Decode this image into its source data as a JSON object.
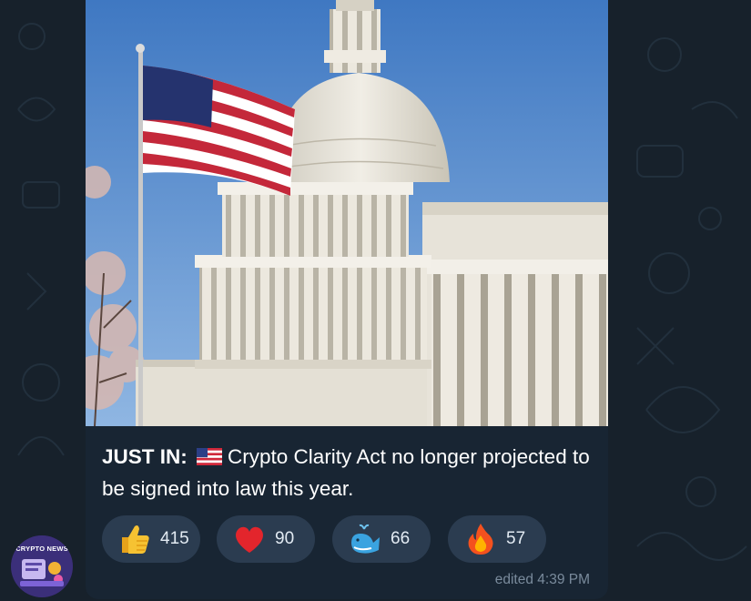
{
  "message": {
    "caption_bold": "JUST IN:",
    "caption_text": "Crypto Clarity Act no longer projected to be signed into law this year.",
    "edited_label": "edited 4:39 PM"
  },
  "reactions": [
    {
      "icon": "thumbs-up-icon",
      "count": "415"
    },
    {
      "icon": "red-heart-icon",
      "count": "90"
    },
    {
      "icon": "whale-icon",
      "count": "66"
    },
    {
      "icon": "fire-icon",
      "count": "57"
    }
  ],
  "channel": {
    "avatar_text": "CRYPTO NEWS"
  },
  "colors": {
    "background": "#17212b",
    "bubble": "#182533",
    "reaction_pill": "#2b3c50",
    "meta_text": "#7a8b9c"
  }
}
